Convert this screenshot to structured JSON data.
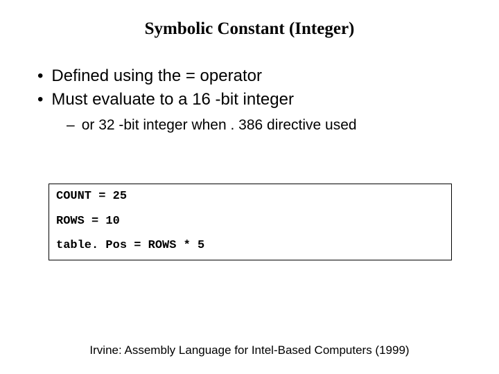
{
  "title": "Symbolic Constant (Integer)",
  "bullets": {
    "item1": "Defined using the = operator",
    "item2": "Must evaluate to a 16 -bit integer",
    "subitem": "or 32 -bit integer when . 386 directive used"
  },
  "code": {
    "line1": "COUNT = 25",
    "line2": "ROWS = 10",
    "line3": "table. Pos = ROWS * 5"
  },
  "footer": "Irvine: Assembly Language for Intel-Based Computers (1999)"
}
